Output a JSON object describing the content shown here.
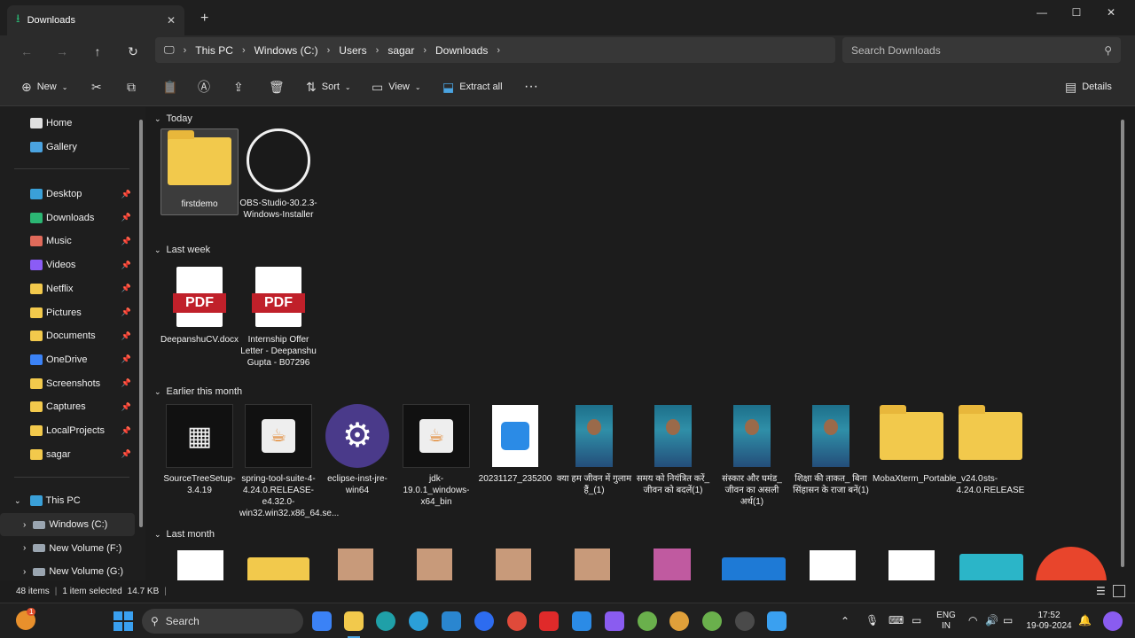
{
  "window": {
    "tab_title": "Downloads",
    "tab_close": "✕",
    "new_tab": "+",
    "min": "—",
    "max": "☐",
    "close": "✕"
  },
  "nav": {
    "breadcrumb": [
      "This PC",
      "Windows (C:)",
      "Users",
      "sagar",
      "Downloads"
    ],
    "search_placeholder": "Search Downloads"
  },
  "toolbar": {
    "new_label": "New",
    "sort_label": "Sort",
    "view_label": "View",
    "extract_label": "Extract all",
    "more_label": "···",
    "details_label": "Details"
  },
  "sidebar": {
    "top": [
      {
        "label": "Home",
        "icon": "home-icon",
        "color": "#e0e0e0"
      },
      {
        "label": "Gallery",
        "icon": "gallery-icon",
        "color": "#4aa3e0"
      }
    ],
    "pinned": [
      {
        "label": "Desktop",
        "icon": "desktop-icon",
        "color": "#3aa0d8"
      },
      {
        "label": "Downloads",
        "icon": "download-icon",
        "color": "#2bb673"
      },
      {
        "label": "Music",
        "icon": "music-icon",
        "color": "#e06a5a"
      },
      {
        "label": "Videos",
        "icon": "video-icon",
        "color": "#8b5cf6"
      },
      {
        "label": "Netflix",
        "icon": "folder-icon",
        "color": "#f2c94c"
      },
      {
        "label": "Pictures",
        "icon": "folder-icon",
        "color": "#f2c94c"
      },
      {
        "label": "Documents",
        "icon": "folder-icon",
        "color": "#f2c94c"
      },
      {
        "label": "OneDrive",
        "icon": "cloud-icon",
        "color": "#3b82f6"
      },
      {
        "label": "Screenshots",
        "icon": "folder-icon",
        "color": "#f2c94c"
      },
      {
        "label": "Captures",
        "icon": "folder-icon",
        "color": "#f2c94c"
      },
      {
        "label": "LocalProjects",
        "icon": "folder-icon",
        "color": "#f2c94c"
      },
      {
        "label": "sagar",
        "icon": "folder-icon",
        "color": "#f2c94c"
      }
    ],
    "this_pc": "This PC",
    "drives": [
      "Windows (C:)",
      "New Volume (F:)",
      "New Volume (G:)"
    ]
  },
  "groups": {
    "today": "Today",
    "last_week": "Last week",
    "earlier_month": "Earlier this month",
    "last_month": "Last month"
  },
  "files": {
    "today": [
      "firstdemo",
      "OBS-Studio-30.2.3-Windows-Installer"
    ],
    "last_week": [
      "DeepanshuCV.docx",
      "Internship Offer Letter - Deepanshu Gupta - B07296"
    ],
    "earlier": [
      "SourceTreeSetup-3.4.19",
      "spring-tool-suite-4-4.24.0.RELEASE-e4.32.0-win32.win32.x86_64.se...",
      "eclipse-inst-jre-win64",
      "jdk-19.0.1_windows-x64_bin",
      "20231127_235200",
      "क्या हम जीवन में गुलाम हैं_(1)",
      "समय को नियंत्रित करें_ जीवन को बदलें(1)",
      "संस्कार और घमंड_ जीवन का असली अर्थ(1)",
      "शिक्षा की ताकत_ बिना सिंहासन के राजा बनें(1)",
      "MobaXterm_Portable_v24.0",
      "sts-4.24.0.RELEASE"
    ]
  },
  "pdf_label": "PDF",
  "status": {
    "items": "48 items",
    "selected": "1 item selected",
    "size": "14.7 KB"
  },
  "taskbar": {
    "search": "Search",
    "lang1": "ENG",
    "lang2": "IN",
    "time": "17:52",
    "date": "19-09-2024",
    "badge": "1"
  }
}
